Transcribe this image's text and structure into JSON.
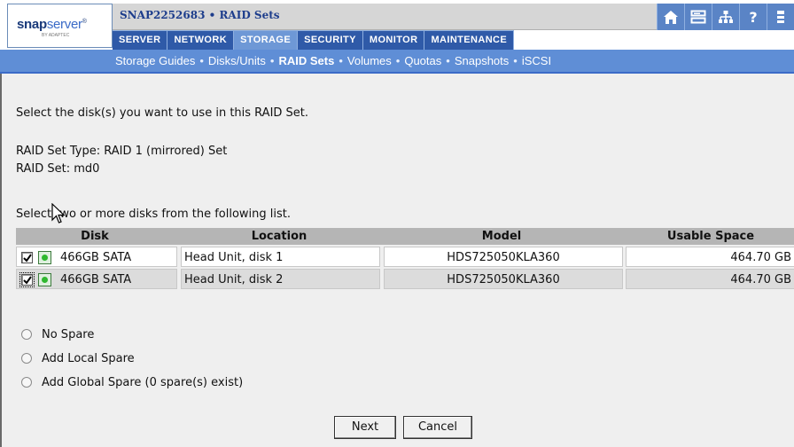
{
  "header": {
    "logo_bold": "snap",
    "logo_thin": "server",
    "logo_tm": "®",
    "logo_sub": "BY ADAPTEC",
    "title": "SNAP2252683 • RAID Sets"
  },
  "top_icons": [
    "home-icon",
    "server-icon",
    "network-tree-icon",
    "help-icon",
    "more-icon"
  ],
  "help_glyph": "?",
  "main_nav": {
    "tabs": [
      {
        "label": "SERVER",
        "active": false
      },
      {
        "label": "NETWORK",
        "active": false
      },
      {
        "label": "STORAGE",
        "active": true
      },
      {
        "label": "SECURITY",
        "active": false
      },
      {
        "label": "MONITOR",
        "active": false
      },
      {
        "label": "MAINTENANCE",
        "active": false
      }
    ]
  },
  "sub_nav": {
    "separator": "•",
    "items": [
      {
        "label": "Storage Guides",
        "active": false
      },
      {
        "label": "Disks/Units",
        "active": false
      },
      {
        "label": "RAID Sets",
        "active": true
      },
      {
        "label": "Volumes",
        "active": false
      },
      {
        "label": "Quotas",
        "active": false
      },
      {
        "label": "Snapshots",
        "active": false
      },
      {
        "label": "iSCSI",
        "active": false
      }
    ]
  },
  "content": {
    "instruction": "Select the disk(s) you want to use in this RAID Set.",
    "raid_type": "RAID Set Type: RAID 1 (mirrored) Set",
    "raid_set": "RAID Set:  md0",
    "table_prompt": "Select two or more disks from the following list."
  },
  "table": {
    "columns": [
      "Disk",
      "Location",
      "Model",
      "Usable Space"
    ],
    "rows": [
      {
        "checked": true,
        "disk": "466GB SATA",
        "location": "Head Unit, disk 1",
        "model": "HDS725050KLA360",
        "space": "464.70 GB"
      },
      {
        "checked": true,
        "disk": "466GB SATA",
        "location": "Head Unit, disk 2",
        "model": "HDS725050KLA360",
        "space": "464.70 GB"
      }
    ]
  },
  "spare_options": [
    {
      "label": "No Spare",
      "selected": false
    },
    {
      "label": "Add Local Spare",
      "selected": false
    },
    {
      "label": "Add Global Spare  (0 spare(s) exist)",
      "selected": false
    }
  ],
  "buttons": {
    "next": "Next",
    "cancel": "Cancel"
  },
  "colors": {
    "nav_blue": "#2f5aa8",
    "subnav_blue": "#5f8ed6",
    "active_tab": "#6e98d6",
    "title_text": "#1d3d8c",
    "led_green": "#2fb82f"
  }
}
